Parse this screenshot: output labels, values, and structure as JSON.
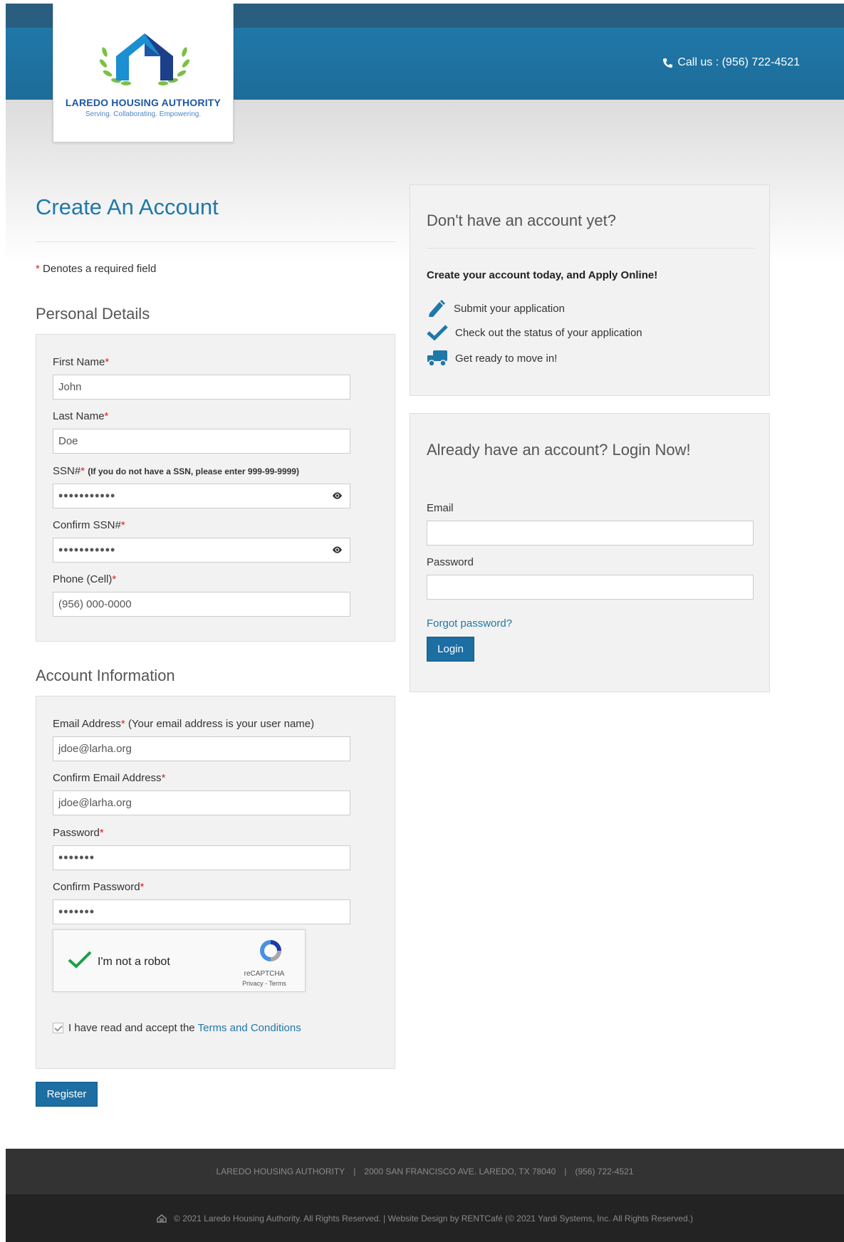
{
  "header": {
    "org_name": "LAREDO HOUSING AUTHORITY",
    "tagline": "Serving. Collaborating. Empowering.",
    "call_us": "Call us : (956) 722-4521"
  },
  "register": {
    "title": "Create An Account",
    "required_note": "Denotes a required field",
    "personal_heading": "Personal Details",
    "fields": {
      "first_name_label": "First Name",
      "first_name_value": "John",
      "last_name_label": "Last Name",
      "last_name_value": "Doe",
      "ssn_label": "SSN#",
      "ssn_note": "(If you do not have a SSN, please enter 999-99-9999)",
      "ssn_value": "•••••••••••",
      "confirm_ssn_label": "Confirm SSN#",
      "confirm_ssn_value": "•••••••••••",
      "phone_label": "Phone (Cell)",
      "phone_value": "(956) 000-0000"
    },
    "account_heading": "Account Information",
    "account": {
      "email_label": "Email Address",
      "email_note": "(Your email address is your user name)",
      "email_value": "jdoe@larha.org",
      "confirm_email_label": "Confirm Email Address",
      "confirm_email_value": "jdoe@larha.org",
      "password_label": "Password",
      "password_value": "•••••••",
      "confirm_password_label": "Confirm Password",
      "confirm_password_value": "•••••••"
    },
    "captcha": {
      "label": "I'm not a robot",
      "brand": "reCAPTCHA",
      "links": "Privacy - Terms"
    },
    "terms_text": "I have read and accept the",
    "terms_link": "Terms and Conditions",
    "register_button": "Register"
  },
  "promo": {
    "heading": "Don't have an account yet?",
    "bold_line": "Create your account today, and Apply Online!",
    "items": [
      {
        "icon": "pencil-icon",
        "text": "Submit your application"
      },
      {
        "icon": "checkmark-icon",
        "text": "Check out the status of your application"
      },
      {
        "icon": "truck-icon",
        "text": "Get ready to move in!"
      }
    ]
  },
  "login": {
    "heading": "Already have an account? Login Now!",
    "email_label": "Email",
    "email_value": "",
    "password_label": "Password",
    "password_value": "",
    "forgot": "Forgot password?",
    "login_button": "Login"
  },
  "footer": {
    "org": "LAREDO HOUSING AUTHORITY",
    "address": "2000 SAN FRANCISCO AVE. LAREDO, TX 78040",
    "phone": "(956) 722-4521",
    "copyright": "© 2021 Laredo Housing Authority. All Rights Reserved. | Website Design by RENTCafé (© 2021 Yardi Systems, Inc. All Rights Reserved.)"
  },
  "colors": {
    "accent": "#1f78a8",
    "header_dark": "#2a5e80",
    "button": "#1c6ea3",
    "required": "#dd2222",
    "footer_top": "#333333",
    "footer_bottom": "#232323"
  }
}
